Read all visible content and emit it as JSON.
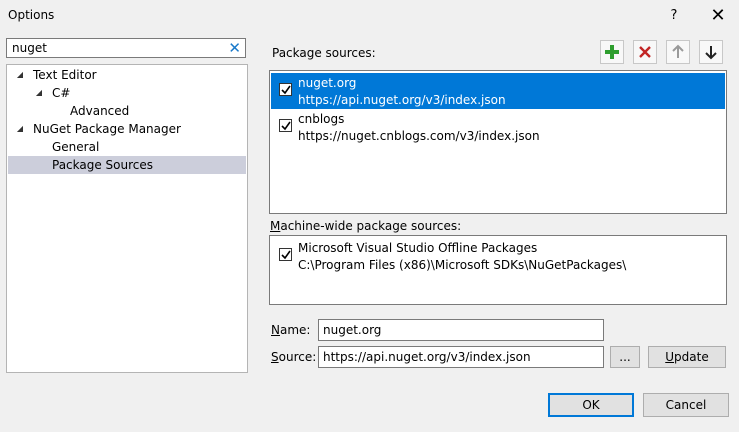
{
  "window": {
    "title": "Options",
    "help_glyph": "?",
    "close_glyph": "✕"
  },
  "search": {
    "value": "nuget",
    "clear_glyph": "✕"
  },
  "tree": [
    {
      "label": "Text Editor",
      "expanded": true
    },
    {
      "label": "C#",
      "expanded": true
    },
    {
      "label": "Advanced"
    },
    {
      "label": "NuGet Package Manager",
      "expanded": true
    },
    {
      "label": "General"
    },
    {
      "label": "Package Sources",
      "selected": true
    }
  ],
  "package_sources": {
    "label": "Package sources:",
    "items": [
      {
        "name": "nuget.org",
        "url": "https://api.nuget.org/v3/index.json",
        "checked": true,
        "selected": true
      },
      {
        "name": "cnblogs",
        "url": "https://nuget.cnblogs.com/v3/index.json",
        "checked": true,
        "selected": false
      }
    ],
    "toolbar": {
      "add_icon": "plus-icon",
      "remove_icon": "x-icon",
      "up_icon": "arrow-up-icon",
      "down_icon": "arrow-down-icon",
      "add_color": "#2e9e2e",
      "remove_color": "#c22525"
    }
  },
  "machine_wide": {
    "label_first": "M",
    "label_rest": "achine-wide package sources:",
    "items": [
      {
        "name": "Microsoft Visual Studio Offline Packages",
        "path": "C:\\Program Files (x86)\\Microsoft SDKs\\NuGetPackages\\",
        "checked": true
      }
    ]
  },
  "form": {
    "name_label_first": "N",
    "name_label_rest": "ame:",
    "name_value": "nuget.org",
    "source_label_first": "S",
    "source_label_rest": "ource:",
    "source_value": "https://api.nuget.org/v3/index.json",
    "browse_label": "...",
    "update_label_first": "U",
    "update_label_rest": "pdate"
  },
  "buttons": {
    "ok": "OK",
    "cancel": "Cancel"
  },
  "colors": {
    "selection": "#0078d7",
    "tree_selection": "#cccedb"
  }
}
